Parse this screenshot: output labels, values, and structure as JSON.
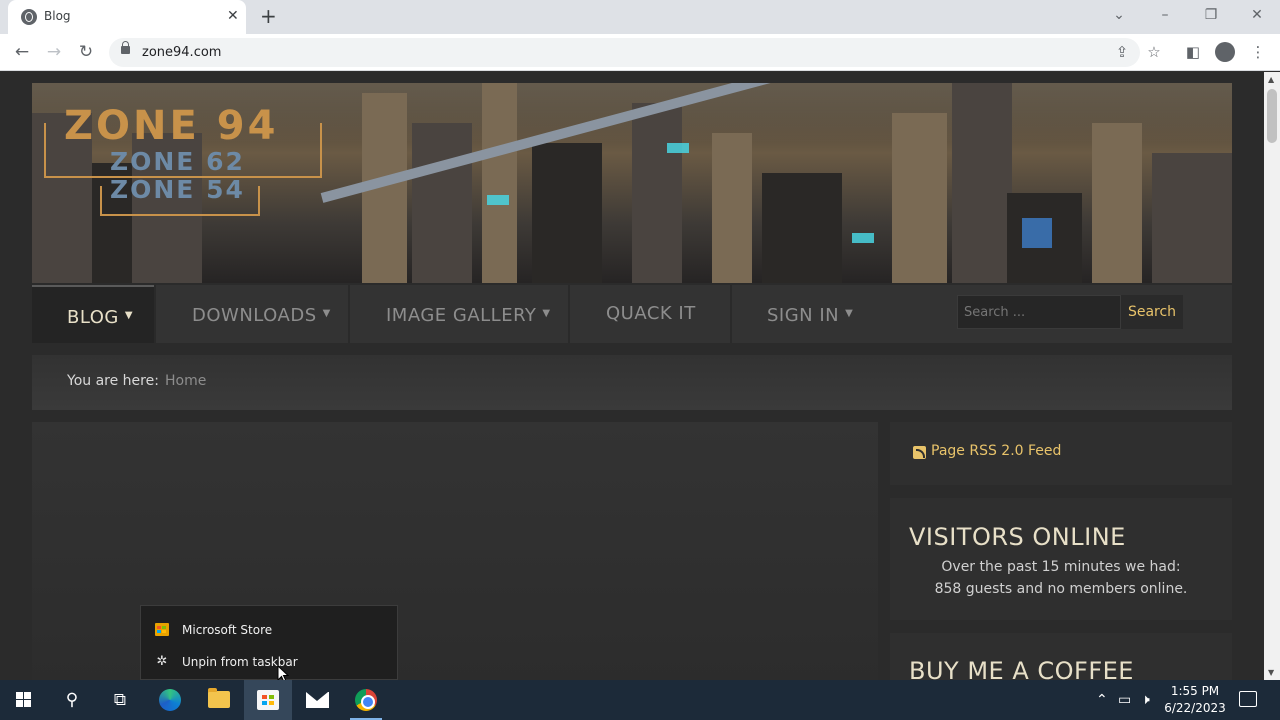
{
  "browser": {
    "tab_title": "Blog",
    "url": "zone94.com"
  },
  "site": {
    "logo": {
      "main": "ZONE 94",
      "sub1": "ZONE 62",
      "sub2": "ZONE 54"
    },
    "nav": {
      "items": [
        {
          "label": "BLOG",
          "has_dropdown": true,
          "active": true
        },
        {
          "label": "DOWNLOADS",
          "has_dropdown": true,
          "active": false
        },
        {
          "label": "IMAGE GALLERY",
          "has_dropdown": true,
          "active": false
        },
        {
          "label": "QUACK IT",
          "has_dropdown": false,
          "active": false
        },
        {
          "label": "SIGN IN",
          "has_dropdown": true,
          "active": false
        }
      ],
      "search_placeholder": "Search ...",
      "search_button": "Search"
    },
    "breadcrumb": {
      "label": "You are here:",
      "current": "Home"
    },
    "sidebar": {
      "rss_link": "Page RSS 2.0 Feed",
      "visitors": {
        "title": "VISITORS ONLINE",
        "line1": "Over the past 15 minutes we had:",
        "line2": "858 guests and no members online."
      },
      "coffee_title": "BUY ME A COFFEE"
    },
    "colors": {
      "accent": "#e8c36a",
      "logo_orange": "#c8924a",
      "logo_blue": "#6d8aa6"
    }
  },
  "context_menu": {
    "items": [
      {
        "label": "Microsoft Store",
        "icon": "store-icon"
      },
      {
        "label": "Unpin from taskbar",
        "icon": "unpin-icon"
      }
    ]
  },
  "taskbar": {
    "time": "1:55 PM",
    "date": "6/22/2023"
  }
}
